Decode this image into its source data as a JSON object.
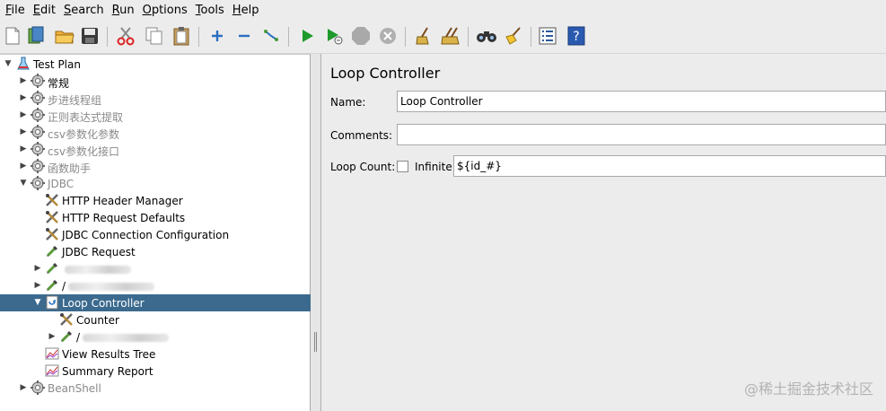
{
  "menubar": {
    "items": [
      {
        "mnemonic": "F",
        "rest": "ile"
      },
      {
        "mnemonic": "E",
        "rest": "dit"
      },
      {
        "mnemonic": "S",
        "rest": "earch"
      },
      {
        "mnemonic": "R",
        "rest": "un"
      },
      {
        "mnemonic": "O",
        "rest": "ptions"
      },
      {
        "mnemonic": "T",
        "rest": "ools"
      },
      {
        "mnemonic": "H",
        "rest": "elp"
      }
    ]
  },
  "toolbar": {
    "icons": [
      "new-icon",
      "templates-icon",
      "open-icon",
      "save-icon",
      "cut-icon",
      "copy-icon",
      "paste-icon",
      "expand-icon",
      "collapse-icon",
      "toggle-icon",
      "start-icon",
      "start-no-pause-icon",
      "stop-icon",
      "shutdown-icon",
      "clear-icon",
      "clear-all-icon",
      "search-icon",
      "reset-search-icon",
      "function-helper-icon",
      "help-icon"
    ]
  },
  "tree": {
    "items": [
      {
        "label": "Test Plan",
        "icon": "test-plan-icon",
        "toggle": "open",
        "style": "normal"
      },
      {
        "label": "常规",
        "icon": "thread-group-icon",
        "toggle": "closed",
        "style": "normal"
      },
      {
        "label": "步进线程组",
        "icon": "thread-group-icon",
        "toggle": "closed",
        "style": "gray"
      },
      {
        "label": "正则表达式提取",
        "icon": "thread-group-icon",
        "toggle": "closed",
        "style": "gray"
      },
      {
        "label": "csv参数化参数",
        "icon": "thread-group-icon",
        "toggle": "closed",
        "style": "gray"
      },
      {
        "label": "csv参数化接口",
        "icon": "thread-group-icon",
        "toggle": "closed",
        "style": "gray"
      },
      {
        "label": "函数助手",
        "icon": "thread-group-icon",
        "toggle": "closed",
        "style": "gray"
      },
      {
        "label": "JDBC",
        "icon": "thread-group-icon",
        "toggle": "open",
        "style": "gray"
      },
      {
        "label": "HTTP Header Manager",
        "icon": "config-element-icon",
        "toggle": "none",
        "style": "normal"
      },
      {
        "label": "HTTP Request Defaults",
        "icon": "config-element-icon",
        "toggle": "none",
        "style": "normal"
      },
      {
        "label": "JDBC Connection Configuration",
        "icon": "config-element-icon",
        "toggle": "none",
        "style": "normal"
      },
      {
        "label": "JDBC Request",
        "icon": "sampler-icon",
        "toggle": "none",
        "style": "normal"
      },
      {
        "label": "",
        "icon": "sampler-icon",
        "toggle": "closed",
        "style": "blurred"
      },
      {
        "label": "/",
        "icon": "sampler-icon",
        "toggle": "closed",
        "style": "blurred"
      },
      {
        "label": "Loop Controller",
        "icon": "loop-controller-icon",
        "toggle": "open",
        "style": "selected"
      },
      {
        "label": "Counter",
        "icon": "config-element-icon",
        "toggle": "none",
        "style": "normal"
      },
      {
        "label": "/",
        "icon": "sampler-icon",
        "toggle": "closed",
        "style": "blurred"
      },
      {
        "label": "View Results Tree",
        "icon": "listener-icon",
        "toggle": "none",
        "style": "normal"
      },
      {
        "label": "Summary Report",
        "icon": "listener-icon",
        "toggle": "none",
        "style": "normal"
      },
      {
        "label": "BeanShell",
        "icon": "thread-group-icon",
        "toggle": "closed",
        "style": "gray"
      }
    ]
  },
  "panel": {
    "title": "Loop Controller",
    "name_label": "Name:",
    "name_value": "Loop Controller",
    "comments_label": "Comments:",
    "comments_value": "",
    "loop_count_label": "Loop Count:",
    "infinite_label": "Infinite",
    "infinite_checked": false,
    "loop_count_value": "${id_#}"
  },
  "watermark": "@稀土掘金技术社区"
}
